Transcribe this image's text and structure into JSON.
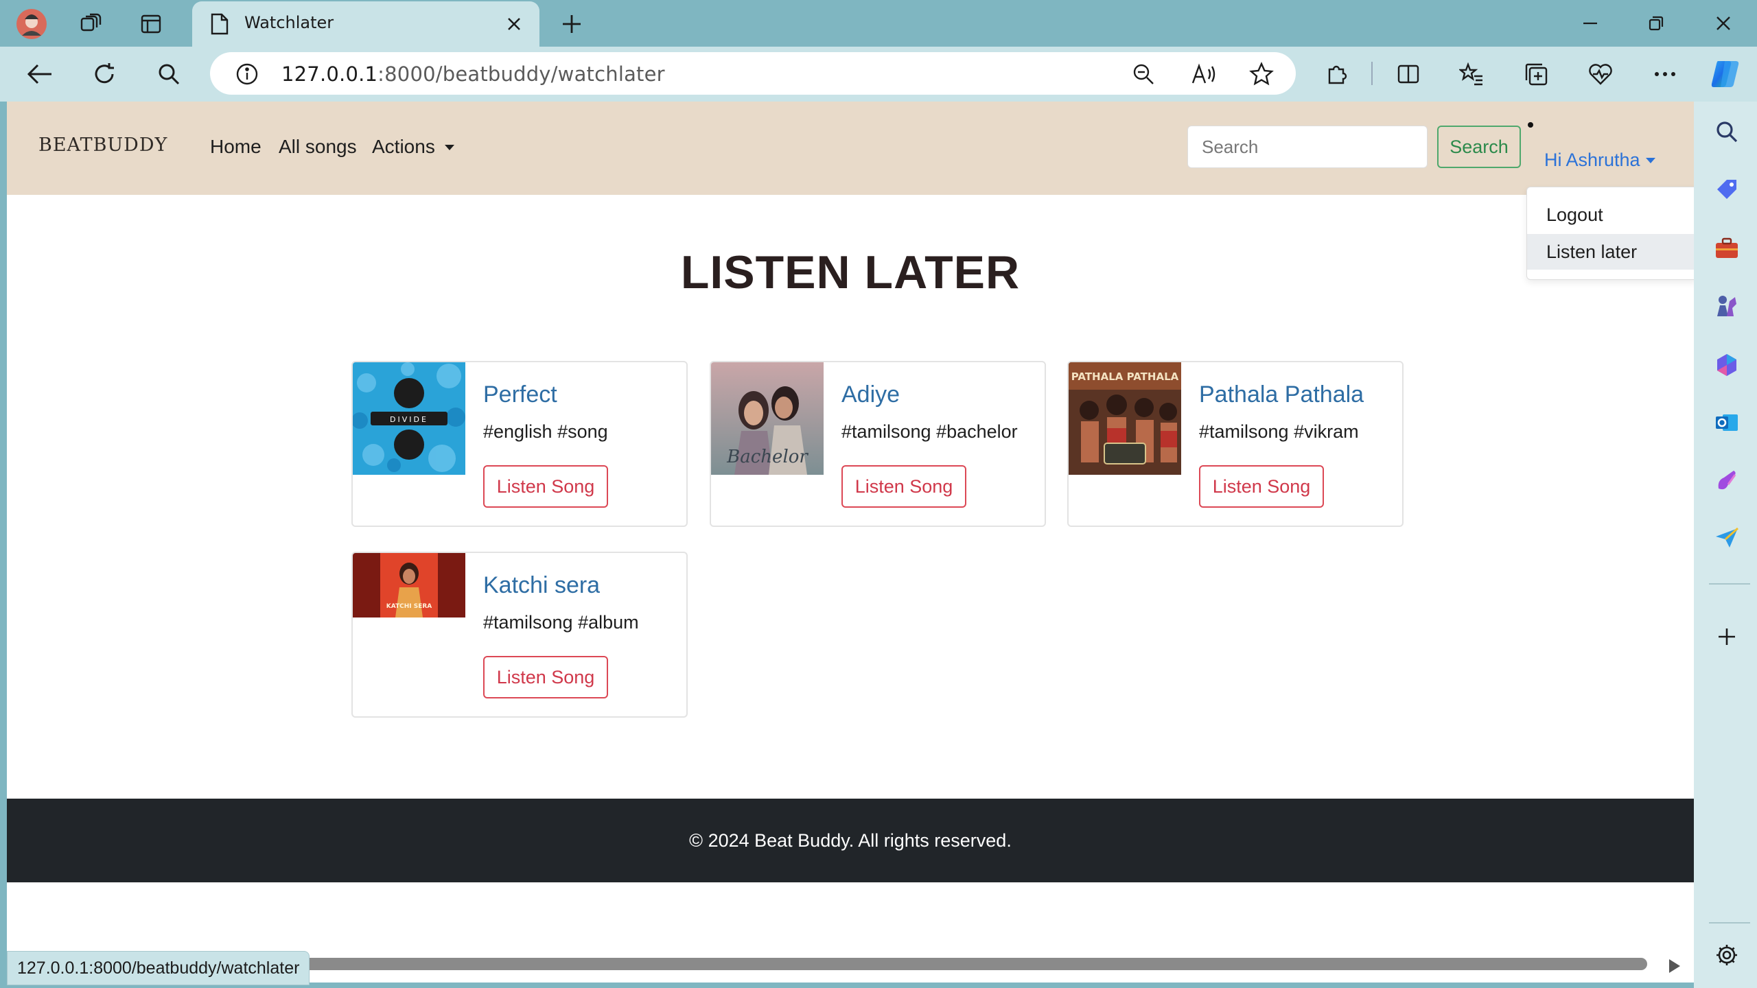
{
  "browser": {
    "tab_title": "Watchlater",
    "url_host": "127.0.0.1",
    "url_rest": ":8000/beatbuddy/watchlater",
    "status_url": "127.0.0.1:8000/beatbuddy/watchlater"
  },
  "navbar": {
    "brand": "BEATBUDDY",
    "links": [
      "Home",
      "All songs",
      "Actions"
    ],
    "search_placeholder": "Search",
    "search_button": "Search",
    "user_greeting": "Hi Ashrutha",
    "dropdown_items": [
      "Logout",
      "Listen later"
    ]
  },
  "page": {
    "heading": "LISTEN LATER",
    "songs": [
      {
        "title": "Perfect",
        "tags": "#english #song",
        "button": "Listen Song",
        "art_text": "DIVIDE"
      },
      {
        "title": "Adiye",
        "tags": "#tamilsong #bachelor",
        "button": "Listen Song",
        "art_text": "Bachelor"
      },
      {
        "title": "Pathala Pathala",
        "tags": "#tamilsong #vikram",
        "button": "Listen Song",
        "art_text": "PATHALA PATHALA"
      },
      {
        "title": "Katchi sera",
        "tags": "#tamilsong #album",
        "button": "Listen Song",
        "art_text": "KATCHI SERA"
      }
    ]
  },
  "footer": {
    "text": "© 2024 Beat Buddy. All rights reserved."
  },
  "colors": {
    "chrome_frame": "#7fb6c1",
    "toolbar": "#c9e3e7",
    "navbar_bg": "#e8dac9",
    "link_blue": "#2e6da4",
    "danger_red": "#dc3545",
    "success_green": "#2c8a4b",
    "footer_bg": "#212529"
  }
}
